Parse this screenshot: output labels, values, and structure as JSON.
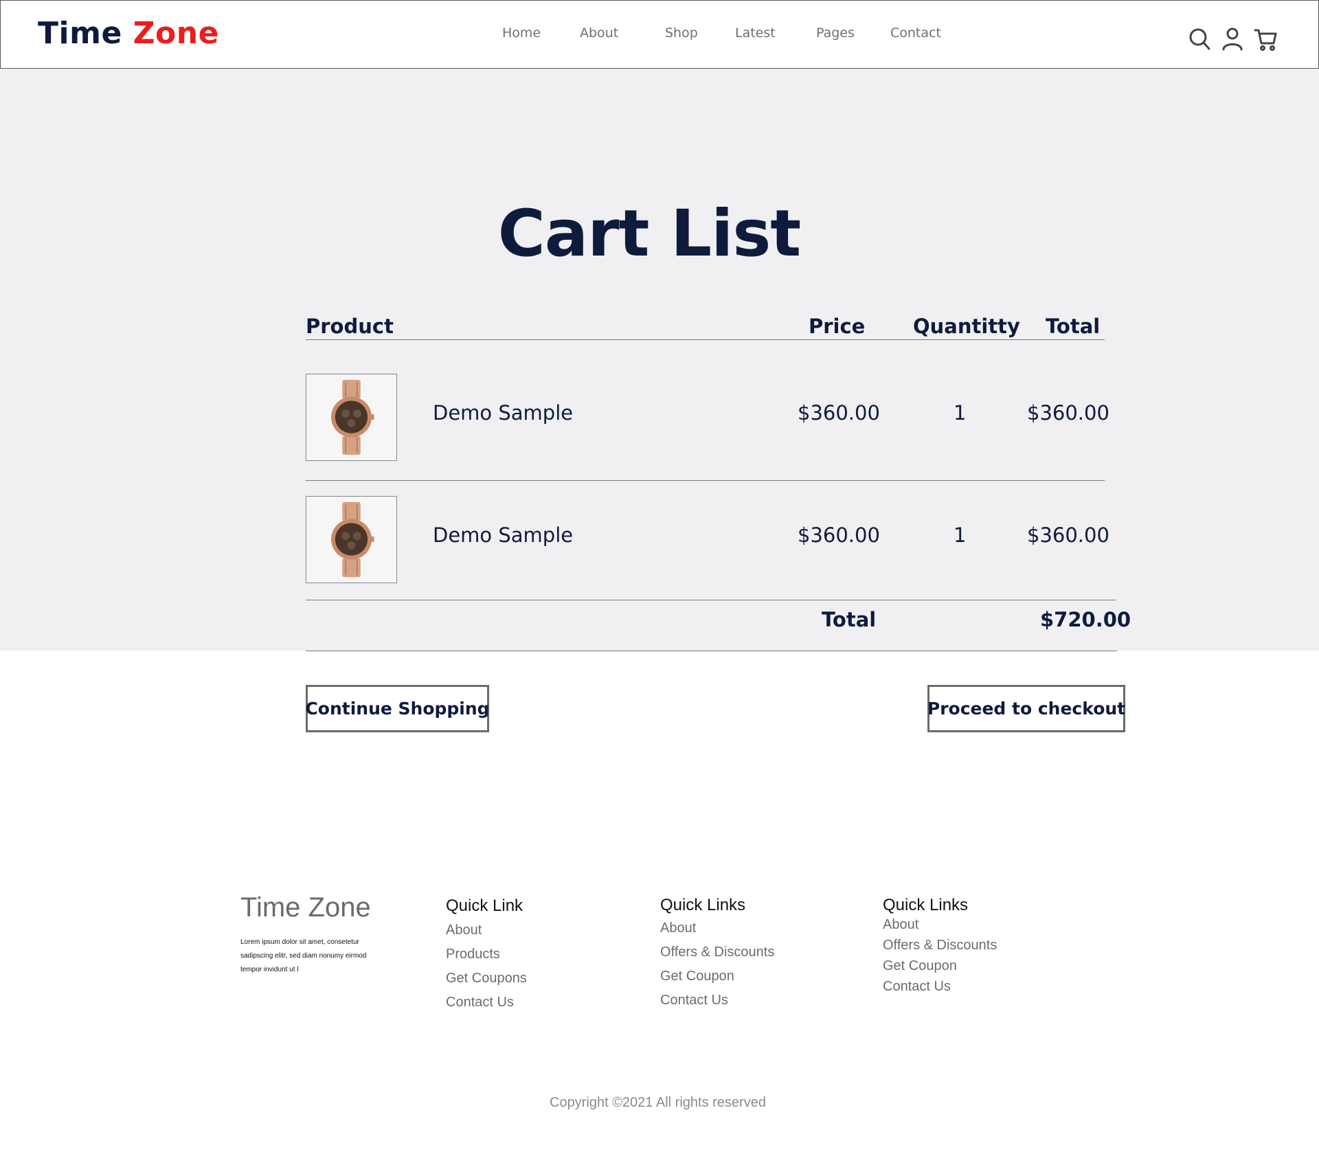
{
  "header": {
    "logo_main": "Time ",
    "logo_accent": "Zone",
    "nav": [
      "Home",
      "About",
      "Shop",
      "Latest",
      "Pages",
      "Contact"
    ],
    "icons": [
      "search-icon",
      "user-icon",
      "cart-icon"
    ]
  },
  "cart": {
    "title": "Cart List",
    "columns": {
      "product": "Product",
      "price": "Price",
      "quantity": "Quantitty",
      "total": "Total"
    },
    "items": [
      {
        "name": "Demo Sample",
        "price": "$360.00",
        "quantity": "1",
        "total": "$360.00"
      },
      {
        "name": "Demo Sample",
        "price": "$360.00",
        "quantity": "1",
        "total": "$360.00"
      }
    ],
    "total_label": "Total",
    "total_value": "$720.00"
  },
  "buttons": {
    "continue": "Continue Shopping",
    "checkout": "Proceed to checkout"
  },
  "footer": {
    "brand": "Time Zone",
    "description": "Lorem ipsum dolor sit amet, consetetur sadipscing elitr, sed diam nonumy eirmod tempor invidunt ut l",
    "columns": [
      {
        "title": "Quick Link",
        "links": [
          "About",
          "Products",
          "Get Coupons",
          "Contact Us"
        ]
      },
      {
        "title": "Quick Links",
        "links": [
          "About",
          "Offers & Discounts",
          "Get Coupon",
          "Contact Us"
        ]
      },
      {
        "title": "Quick Links",
        "links": [
          "About",
          "Offers & Discounts",
          "Get Coupon",
          "Contact Us"
        ]
      }
    ],
    "copyright": "Copyright ©2021 All rights reserved"
  },
  "colors": {
    "navy": "#0f1b3d",
    "accent_red": "#ee1c1c",
    "cart_background": "#f0f0f2",
    "muted_text": "#6b6b6b"
  }
}
